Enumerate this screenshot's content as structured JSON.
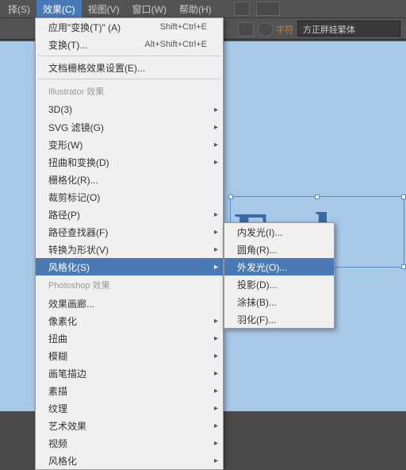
{
  "menubar": {
    "items": [
      "择(S)",
      "效果(C)",
      "视图(V)",
      "窗口(W)",
      "帮助(H)"
    ],
    "activeIndex": 1
  },
  "toolbar": {
    "charLabel": "字符",
    "fontName": "方正胖娃繁体"
  },
  "canvas": {
    "text": "Feel"
  },
  "menu1": {
    "topItems": [
      {
        "label": "应用\"变换(T)\" (A)",
        "shortcut": "Shift+Ctrl+E"
      },
      {
        "label": "变换(T)...",
        "shortcut": "Alt+Shift+Ctrl+E"
      }
    ],
    "docGrid": "文档栅格效果设置(E)...",
    "sectionIllustrator": "Illustrator 效果",
    "illustratorItems": [
      {
        "label": "3D(3)",
        "sub": true
      },
      {
        "label": "SVG 滤镜(G)",
        "sub": true
      },
      {
        "label": "变形(W)",
        "sub": true
      },
      {
        "label": "扭曲和变换(D)",
        "sub": true
      },
      {
        "label": "栅格化(R)...",
        "sub": false
      },
      {
        "label": "裁剪标记(O)",
        "sub": false
      },
      {
        "label": "路径(P)",
        "sub": true
      },
      {
        "label": "路径查找器(F)",
        "sub": true
      },
      {
        "label": "转换为形状(V)",
        "sub": true
      },
      {
        "label": "风格化(S)",
        "sub": true,
        "highlight": true
      }
    ],
    "sectionPhotoshop": "Photoshop 效果",
    "photoshopItems": [
      {
        "label": "效果画廊...",
        "sub": false
      },
      {
        "label": "像素化",
        "sub": true
      },
      {
        "label": "扭曲",
        "sub": true
      },
      {
        "label": "模糊",
        "sub": true
      },
      {
        "label": "画笔描边",
        "sub": true
      },
      {
        "label": "素描",
        "sub": true
      },
      {
        "label": "纹理",
        "sub": true
      },
      {
        "label": "艺术效果",
        "sub": true
      },
      {
        "label": "视频",
        "sub": true
      },
      {
        "label": "风格化",
        "sub": true
      }
    ]
  },
  "menu2": {
    "items": [
      {
        "label": "内发光(I)..."
      },
      {
        "label": "圆角(R)..."
      },
      {
        "label": "外发光(O)...",
        "highlight": true
      },
      {
        "label": "投影(D)..."
      },
      {
        "label": "涂抹(B)..."
      },
      {
        "label": "羽化(F)..."
      }
    ]
  }
}
